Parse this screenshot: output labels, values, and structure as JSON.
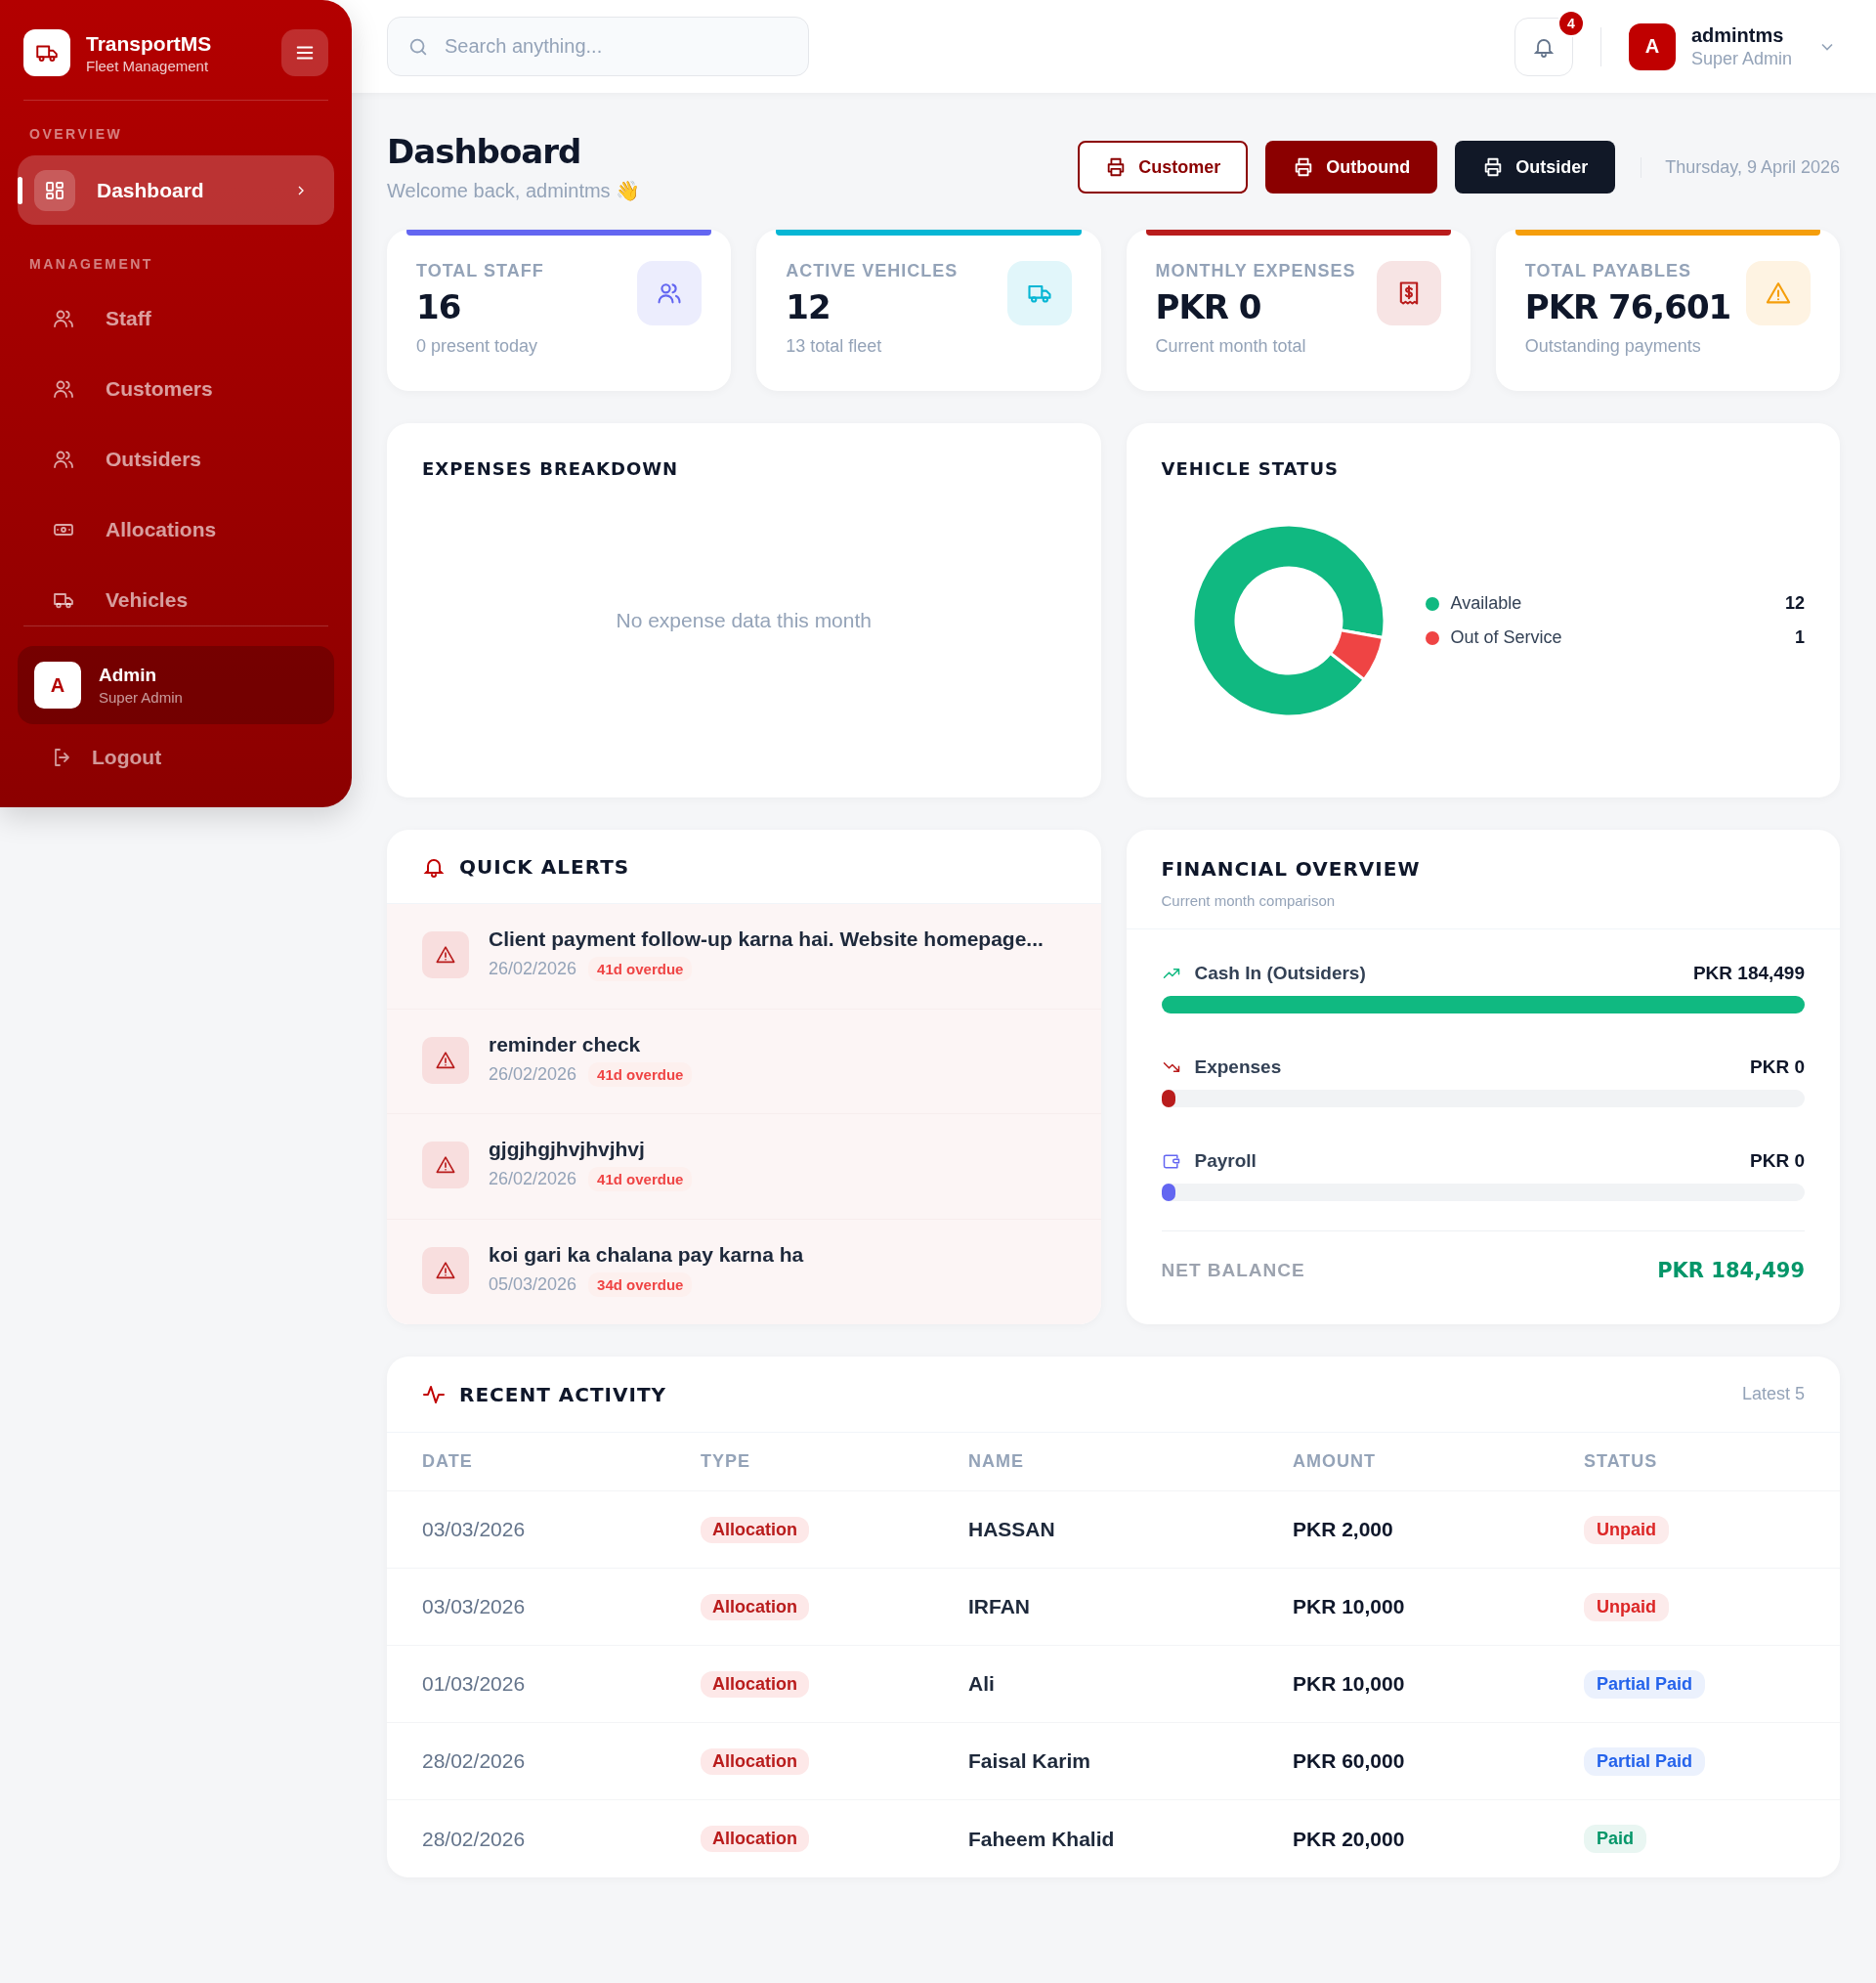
{
  "sidebar": {
    "brand": {
      "title": "TransportMS",
      "subtitle": "Fleet Management"
    },
    "sections": [
      {
        "heading": "OVERVIEW",
        "items": [
          {
            "label": "Dashboard",
            "kind": "grid",
            "selected": true
          }
        ]
      },
      {
        "heading": "MANAGEMENT",
        "items": [
          {
            "label": "Staff",
            "kind": "users",
            "selected": false
          },
          {
            "label": "Customers",
            "kind": "users",
            "selected": false
          },
          {
            "label": "Outsiders",
            "kind": "users",
            "selected": false
          },
          {
            "label": "Allocations",
            "kind": "cash",
            "selected": false
          },
          {
            "label": "Vehicles",
            "kind": "truck",
            "selected": false
          }
        ]
      }
    ],
    "user": {
      "avatar": "A",
      "name": "Admin",
      "role": "Super Admin"
    },
    "logout": "Logout"
  },
  "topbar": {
    "search": {
      "placeholder": "Search anything..."
    },
    "notifications": "4",
    "user": {
      "avatar": "A",
      "name": "admintms",
      "role": "Super Admin"
    }
  },
  "page": {
    "title": "Dashboard",
    "subtitle": "Welcome back, admintms 👋",
    "buttons": [
      {
        "label": "Customer",
        "kind": "outline"
      },
      {
        "label": "Outbound",
        "kind": "primary"
      },
      {
        "label": "Outsider",
        "kind": "dark"
      }
    ],
    "date": "Thursday, 9 April 2026"
  },
  "stats": [
    {
      "label": "TOTAL STAFF",
      "value": "16",
      "note": "0 present today",
      "kind": "users",
      "color": "#6366f1"
    },
    {
      "label": "ACTIVE VEHICLES",
      "value": "12",
      "note": "13 total fleet",
      "kind": "truck",
      "color": "#06b6d4"
    },
    {
      "label": "MONTHLY EXPENSES",
      "value": "PKR 0",
      "note": "Current month total",
      "kind": "receipt",
      "color": "#b91c1c"
    },
    {
      "label": "TOTAL PAYABLES",
      "value": "PKR 76,601",
      "note": "Outstanding payments",
      "kind": "warning",
      "color": "#f59e0b"
    }
  ],
  "expenses_breakdown": {
    "title": "EXPENSES BREAKDOWN",
    "empty_message": "No expense data this month"
  },
  "vehicle_status": {
    "title": "VEHICLE STATUS",
    "chart_data": {
      "type": "donut",
      "categories": [
        "Available",
        "Out of Service"
      ],
      "values": [
        92.31,
        7.69
      ]
    },
    "legend": [
      {
        "count": "12",
        "color": "#10b981"
      },
      {
        "count": "1",
        "color": "#ef4444"
      }
    ]
  },
  "quick_alerts": {
    "title": "QUICK ALERTS",
    "items": [
      {
        "title": "Client payment follow-up karna hai. Website homepage...",
        "date": "26/02/2026",
        "badge": "41d overdue"
      },
      {
        "title": "reminder check",
        "date": "26/02/2026",
        "badge": "41d overdue"
      },
      {
        "title": "gjgjhgjhvjhvjhvj",
        "date": "26/02/2026",
        "badge": "41d overdue"
      },
      {
        "title": "koi gari ka chalana pay karna ha",
        "date": "05/03/2026",
        "badge": "34d overdue"
      }
    ]
  },
  "financial_overview": {
    "title": "FINANCIAL OVERVIEW",
    "subtitle": "Current month comparison",
    "rows": [
      {
        "label": "Cash In (Outsiders)",
        "amount": "PKR 184,499",
        "level": 1,
        "kind": "trend-up",
        "color": "#10b981"
      },
      {
        "label": "Expenses",
        "amount": "PKR 0",
        "level": 0,
        "kind": "trend-down",
        "color": "#b91c1c"
      },
      {
        "label": "Payroll",
        "amount": "PKR 0",
        "level": 0,
        "kind": "wallet",
        "color": "#6366f1"
      }
    ],
    "net_label": "NET BALANCE",
    "net_value": "PKR 184,499"
  },
  "recent_activity": {
    "title": "RECENT ACTIVITY",
    "note": "Latest 5",
    "columns": [
      "DATE",
      "TYPE",
      "NAME",
      "AMOUNT",
      "STATUS"
    ],
    "rows": [
      {
        "date": "03/03/2026",
        "type": "Allocation",
        "name": "HASSAN",
        "amount": "PKR 2,000",
        "status": "Unpaid",
        "color": "#dc2626"
      },
      {
        "date": "03/03/2026",
        "type": "Allocation",
        "name": "IRFAN",
        "amount": "PKR 10,000",
        "status": "Unpaid",
        "color": "#dc2626"
      },
      {
        "date": "01/03/2026",
        "type": "Allocation",
        "name": "Ali",
        "amount": "PKR 10,000",
        "status": "Partial Paid",
        "color": "#2563eb"
      },
      {
        "date": "28/02/2026",
        "type": "Allocation",
        "name": "Faisal Karim",
        "amount": "PKR 60,000",
        "status": "Partial Paid",
        "color": "#2563eb"
      },
      {
        "date": "28/02/2026",
        "type": "Allocation",
        "name": "Faheem Khalid",
        "amount": "PKR 20,000",
        "status": "Paid",
        "color": "#059669"
      }
    ]
  }
}
